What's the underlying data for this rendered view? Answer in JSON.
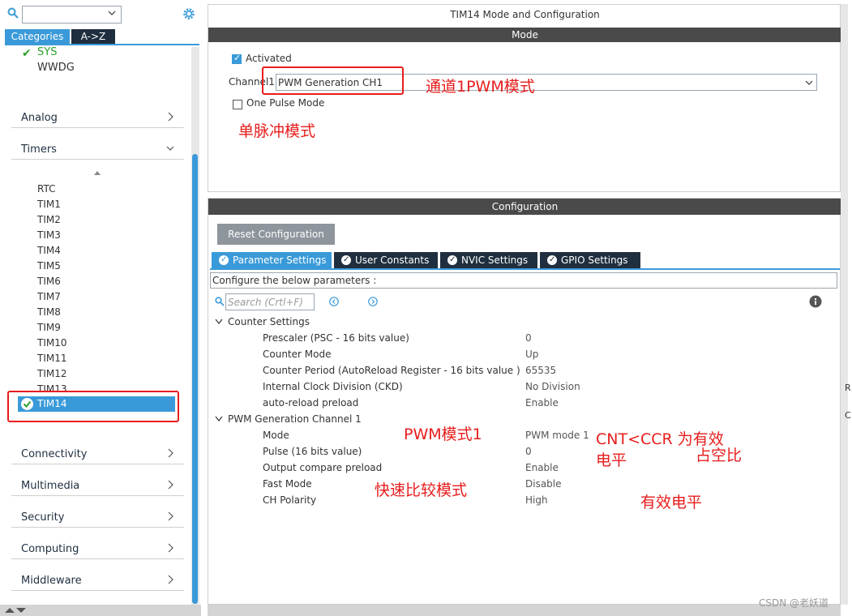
{
  "sidebar": {
    "search_value": "",
    "tabs": [
      "Categories",
      "A->Z"
    ],
    "system_items": [
      "SYS",
      "WWDG"
    ],
    "sections": [
      "Analog",
      "Timers",
      "Connectivity",
      "Multimedia",
      "Security",
      "Computing",
      "Middleware"
    ],
    "timers": [
      "RTC",
      "TIM1",
      "TIM2",
      "TIM3",
      "TIM4",
      "TIM5",
      "TIM6",
      "TIM7",
      "TIM8",
      "TIM9",
      "TIM10",
      "TIM11",
      "TIM12",
      "TIM13"
    ],
    "selected": "TIM14"
  },
  "mode": {
    "title": "TIM14 Mode and Configuration",
    "header": "Mode",
    "activated_label": "Activated",
    "activated_checked": true,
    "channel_label": "Channel1",
    "channel_value": "PWM Generation CH1",
    "one_pulse_label": "One Pulse Mode",
    "one_pulse_checked": false
  },
  "config": {
    "header": "Configuration",
    "reset_label": "Reset Configuration",
    "tabs": [
      "Parameter Settings",
      "User Constants",
      "NVIC Settings",
      "GPIO Settings"
    ],
    "configure_text": "Configure the below parameters :",
    "search_placeholder": "Search (Crtl+F)",
    "groups": [
      {
        "name": "Counter Settings",
        "params": [
          {
            "name": "Prescaler (PSC - 16 bits value)",
            "value": "0"
          },
          {
            "name": "Counter Mode",
            "value": "Up"
          },
          {
            "name": "Counter Period (AutoReload Register - 16 bits value )",
            "value": "65535"
          },
          {
            "name": "Internal Clock Division (CKD)",
            "value": "No Division"
          },
          {
            "name": "auto-reload preload",
            "value": "Enable"
          }
        ]
      },
      {
        "name": "PWM Generation Channel 1",
        "params": [
          {
            "name": "Mode",
            "value": "PWM mode 1"
          },
          {
            "name": "Pulse (16 bits value)",
            "value": "0"
          },
          {
            "name": "Output compare preload",
            "value": "Enable"
          },
          {
            "name": "Fast Mode",
            "value": "Disable"
          },
          {
            "name": "CH Polarity",
            "value": "High"
          }
        ]
      }
    ]
  },
  "annotations": {
    "channel_pwm": "通道1PWM模式",
    "single_pulse": "单脉冲模式",
    "pwm_mode1": "PWM模式1",
    "cnt_ccr_line1": "CNT<CCR 为有效",
    "cnt_ccr_line2": "电平",
    "duty_cycle": "占空比",
    "fast_compare": "快速比较模式",
    "active_level": "有效电平"
  },
  "edge_text": {
    "r": "R",
    "c": "C"
  },
  "watermark": "CSDN @老妖道",
  "colors": {
    "accent": "#3a9ad9",
    "dark_tab": "#1f2f3f",
    "header": "#4a4a4a",
    "annotation": "#e81c1c",
    "check": "#2ca02c"
  }
}
